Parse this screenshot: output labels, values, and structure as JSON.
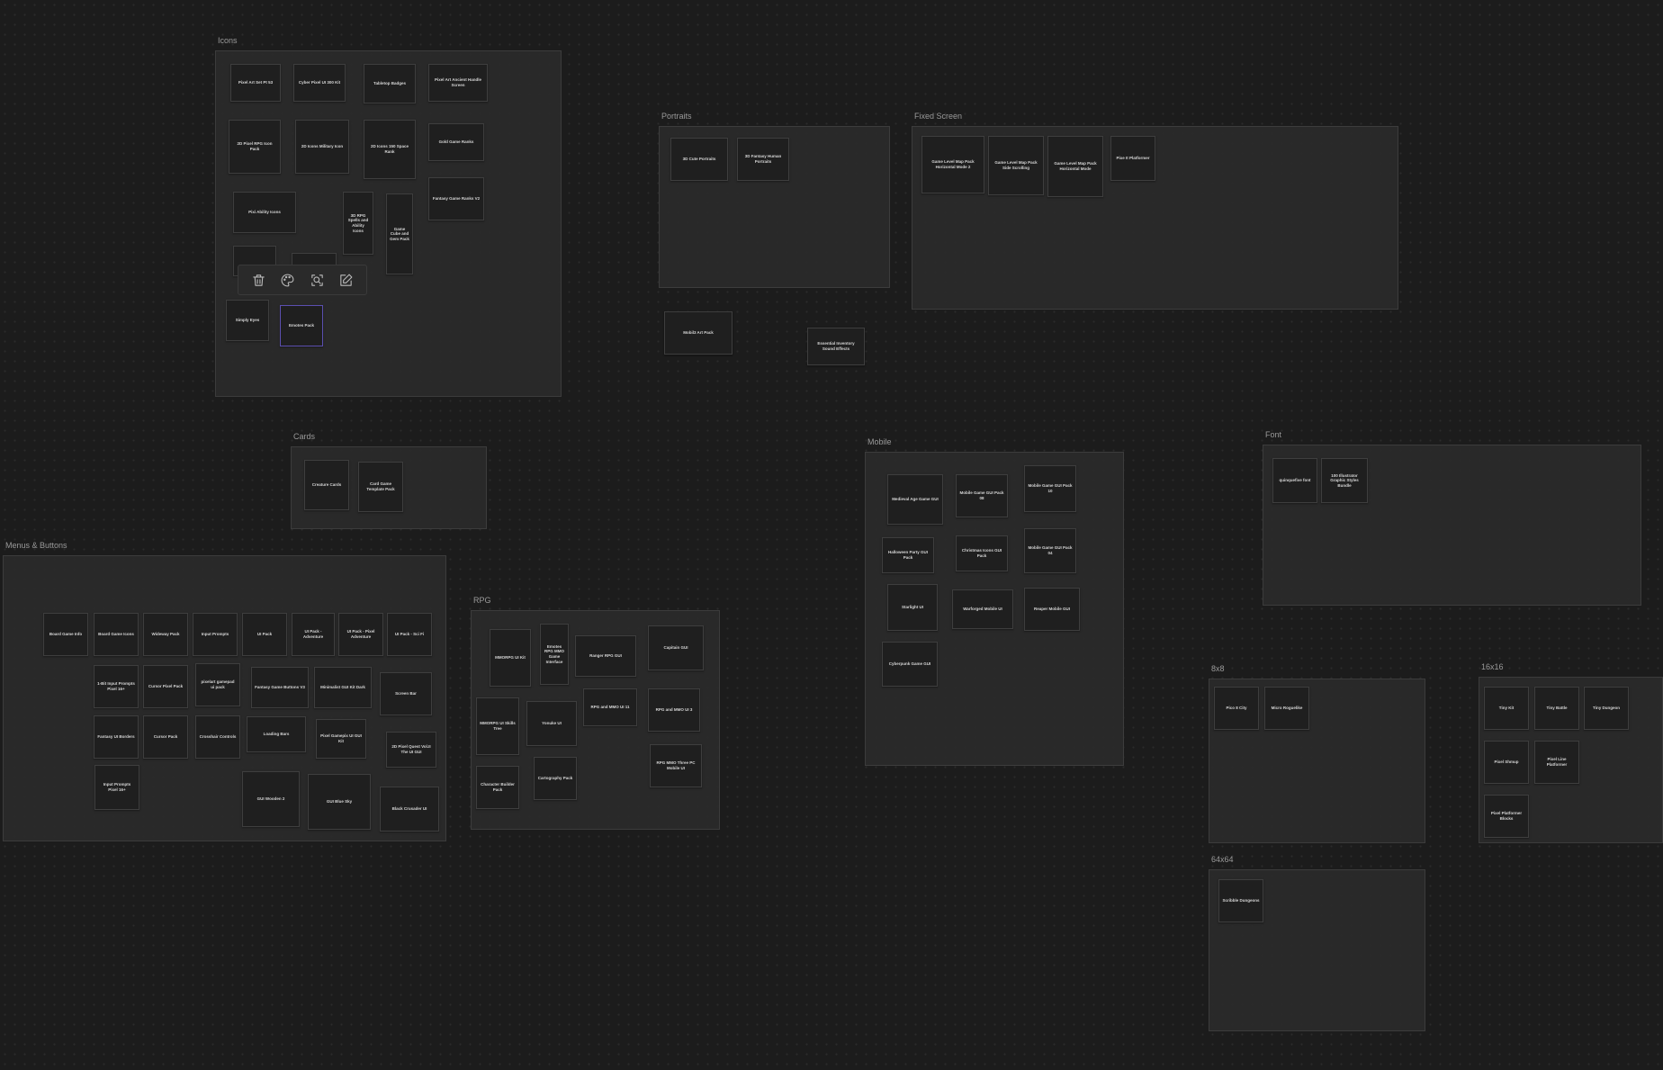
{
  "groups": {
    "icons": "Icons",
    "portraits": "Portraits",
    "fixed_screen": "Fixed Screen",
    "cards": "Cards",
    "mobile": "Mobile",
    "font": "Font",
    "menus": "Menus & Buttons",
    "rpg": "RPG",
    "g8x8": "8x8",
    "g16x16": "16x16",
    "g64x64": "64x64"
  },
  "toolbar": {
    "delete_icon": "trash-icon",
    "color_icon": "palette-icon",
    "inspect_icon": "zoom-search-icon",
    "edit_icon": "edit-icon"
  },
  "cards": {
    "icons": [
      "Pixel Art Set Pt 53",
      "Cyber Pixel UI 300 Kit",
      "Tabletop Badges",
      "Pixel Art Ancient Handle Screen",
      "2D Pixel RPG Icon Pack",
      "2D Icons Military Icon",
      "2D Icons 150 Space Rank",
      "Gold Game Ranks",
      "Pixi Ability Icons",
      "3D RPG Spells and Ability Icons",
      "Game Cube and Gem Pack",
      "Fantasy Game Ranks V2",
      "Simply Eyes",
      "Emotes Pack"
    ],
    "portraits": [
      "3D Cute Portraits",
      "3D Fantasy Human Portraits"
    ],
    "fixed_screen": [
      "Game Level Map Pack Horizontal Mode 2",
      "Game Level Map Pack Side Scrolling",
      "Game Level Map Pack Horizontal Mode",
      "Pixe It Platformer"
    ],
    "loose": [
      "Mobil3 Art Pack",
      "Essential Inventory Sound Effects"
    ],
    "cards": [
      "Creature Cards",
      "Card Game Template Pack"
    ],
    "mobile": [
      "Medieval Age Game GUI",
      "Mobile Game GUI Pack 08",
      "Mobile Game GUI Pack 10",
      "Halloween Party GUI Pack",
      "Christmas Icons GUI Pack",
      "Mobile Game GUI Pack 04",
      "Starlight UI",
      "Warforged Mobile UI",
      "Reaper Mobile GUI",
      "Cyberpunk Game GUI"
    ],
    "font": [
      "quinquefive font",
      "100 Illustrator Graphic Styles Bundle"
    ],
    "menus": [
      "Board Game Info",
      "Board Game Icons",
      "Wideway Pack",
      "Input Prompts",
      "UI Pack",
      "UI Pack - Adventure",
      "UI Pack - Pixel Adventure",
      "UI Pack - Sci Fi",
      "1-Bit Input Prompts Pixel 16+",
      "Cursor Pixel Pack",
      "pixelart gamepad ui pack",
      "Fantasy Game Buttons V3",
      "Minimalist GUI Kit Dark",
      "Screen Bar",
      "Fantasy UI Borders",
      "Cursor Pack",
      "Crosshair Controls",
      "Loading Bars",
      "Pixel Gamepix UI GUI Kit",
      "2D Pixel Quest Vol.II The UI GUI",
      "Input Prompts Pixel 16+",
      "GUI Wooden 2",
      "GUI Blue Sky",
      "Black Crusader UI"
    ],
    "rpg": [
      "MMORPG UI Kit",
      "Emotes RPG MMO Game Interface",
      "Ranger RPG GUI",
      "Capitain GUI",
      "MMORPG UI Skills Tree",
      "Yonuke UI",
      "RPG and MMO UI 11",
      "RPG and MMO UI 3",
      "Character Builder Pack",
      "Cartography Pack",
      "RPG MMO Three PC Mobile UI"
    ],
    "g8x8": [
      "Pico 8 City",
      "Micro Roguelike"
    ],
    "g16x16": [
      "Tiny Kit",
      "Tiny Battle",
      "Tiny Dungeon",
      "Pixel Shmup",
      "Pixel Line Platformer",
      "Pixel Platformer Blocks"
    ],
    "g64x64": [
      "Scribble Dungeons"
    ]
  }
}
